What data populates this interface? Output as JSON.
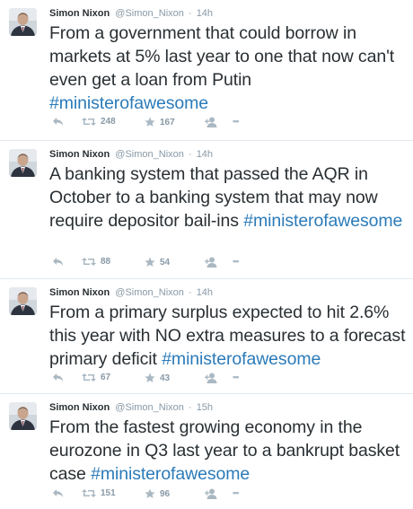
{
  "tweets": [
    {
      "name": "Simon Nixon",
      "handle": "@Simon_Nixon",
      "time": "14h",
      "text": "From a government that could borrow in markets at 5% last year to one that now can't even get a loan from Putin ",
      "hashtag": "#ministerofawesome",
      "retweets": "248",
      "favorites": "167"
    },
    {
      "name": "Simon Nixon",
      "handle": "@Simon_Nixon",
      "time": "14h",
      "text": "A banking system that passed the AQR in October to a banking system that may now require depositor bail-ins ",
      "hashtag": "#ministerofawesome",
      "retweets": "88",
      "favorites": "54"
    },
    {
      "name": "Simon Nixon",
      "handle": "@Simon_Nixon",
      "time": "14h",
      "text": "From a primary surplus expected to hit 2.6% this year with NO extra measures to a forecast primary deficit ",
      "hashtag": "#ministerofawesome",
      "retweets": "67",
      "favorites": "43"
    },
    {
      "name": "Simon Nixon",
      "handle": "@Simon_Nixon",
      "time": "15h",
      "text": "From the fastest growing economy in the eurozone in Q3 last year to a bankrupt basket case ",
      "hashtag": "#ministerofawesome",
      "retweets": "151",
      "favorites": "96"
    }
  ],
  "separator": "·",
  "more_glyph": "•••",
  "colors": {
    "hashtag": "#2b7bb9",
    "meta": "#8899a6",
    "text": "#292f33",
    "divider": "#e1e8ed"
  },
  "icons": [
    "reply-icon",
    "retweet-icon",
    "favorite-icon",
    "follow-icon",
    "more-icon"
  ]
}
